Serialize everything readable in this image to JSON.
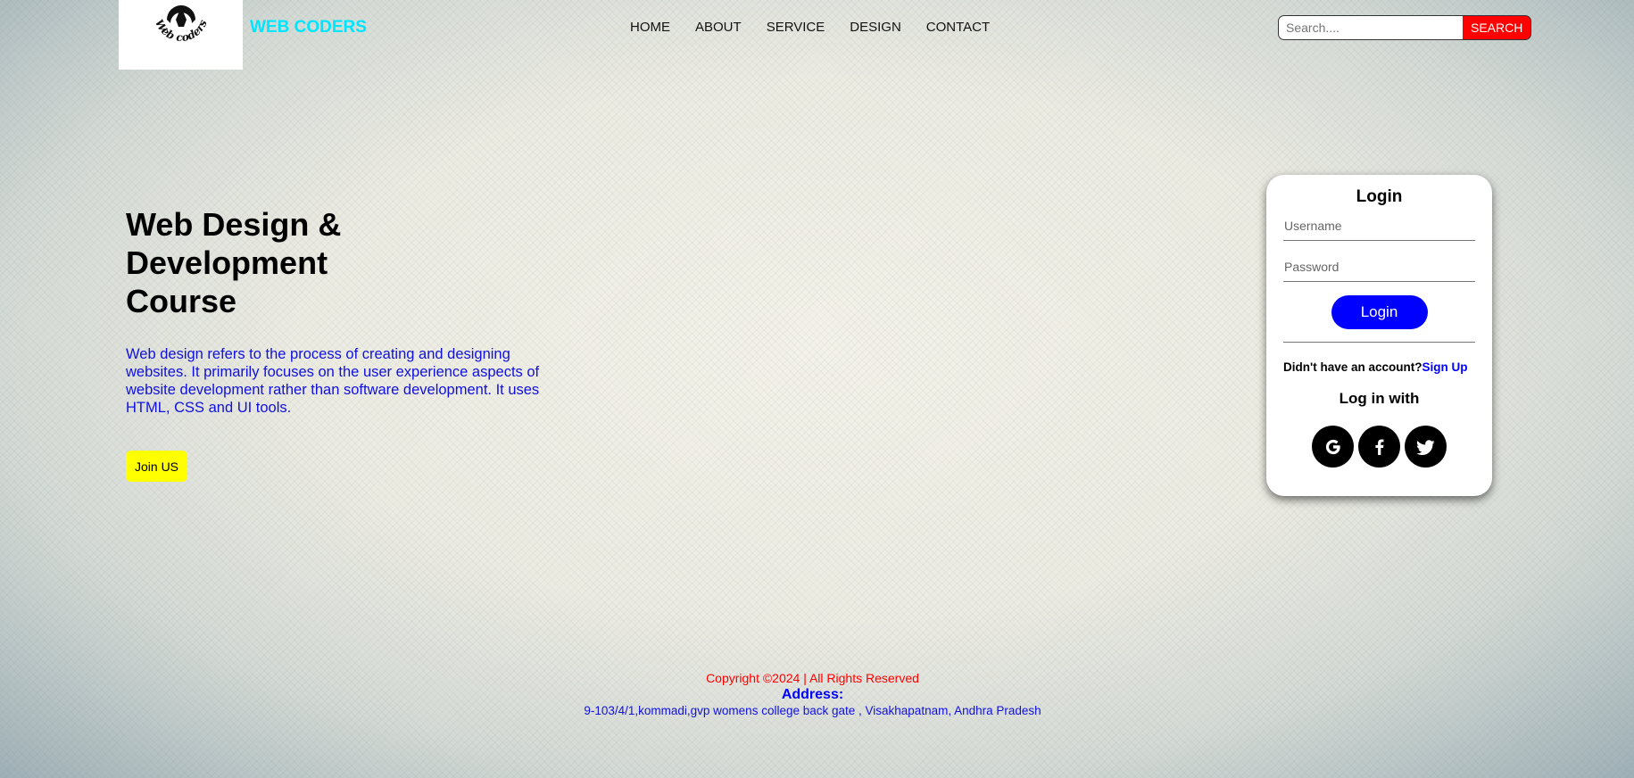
{
  "header": {
    "logo_text": "Web coders",
    "brand": "WEB CODERS",
    "nav": [
      {
        "label": "HOME"
      },
      {
        "label": "ABOUT"
      },
      {
        "label": "SERVICE"
      },
      {
        "label": "DESIGN"
      },
      {
        "label": "CONTACT"
      }
    ],
    "search": {
      "placeholder": "Search....",
      "button_label": "SEARCH"
    }
  },
  "hero": {
    "title_line1": "Web Design &",
    "title_line2": "Development",
    "title_line3": "Course",
    "text": "Web design refers to the process of creating and designing websites. It primarily focuses on the user experience aspects of website development rather than software development. It uses HTML, CSS and UI tools.",
    "join_label": "Join US"
  },
  "login": {
    "title": "Login",
    "username_placeholder": "Username",
    "password_placeholder": "Password",
    "button_label": "Login",
    "no_account_text": "Didn't have an account?",
    "signup_label": "Sign Up",
    "login_with": "Log in with",
    "socials": [
      "google-icon",
      "facebook-icon",
      "twitter-icon"
    ]
  },
  "footer": {
    "copyright": "Copyright ©2024 | All Rights Reserved",
    "address_label": "Address:",
    "address": "9-103/4/1,kommadi,gvp womens college back gate , Visakhapatnam, Andhra Pradesh"
  },
  "colors": {
    "brand": "#00e5ff",
    "search_button": "#ff0000",
    "login_button": "#0000ff",
    "join_button": "#ffff00",
    "hero_text": "#1010e0",
    "copyright": "#ff0000"
  }
}
